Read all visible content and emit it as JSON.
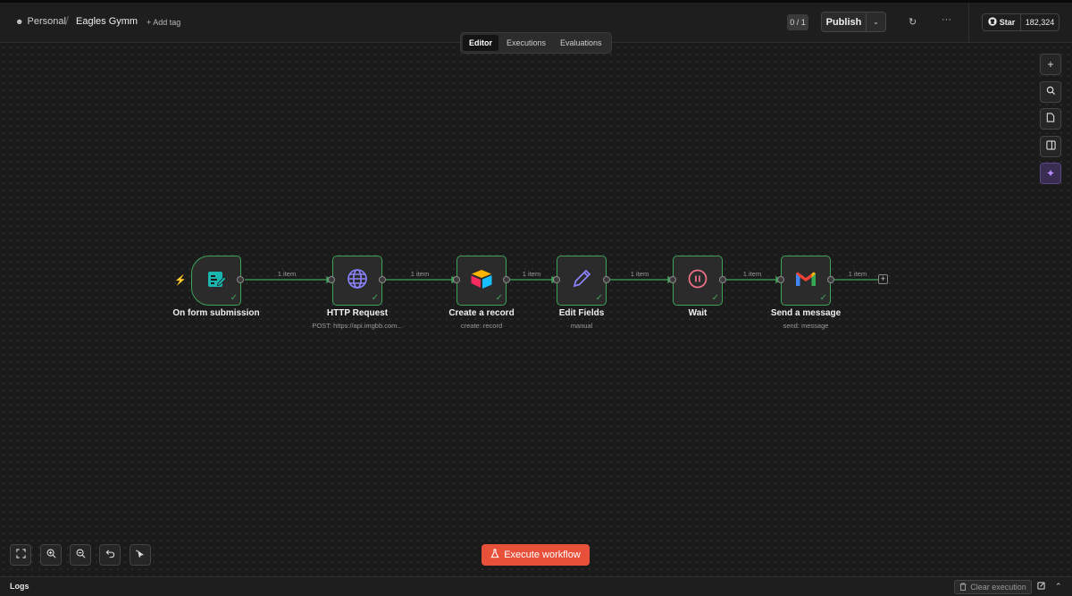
{
  "header": {
    "personal": "Personal",
    "separator": "/",
    "workflow_name": "Eagles Gymm",
    "add_tag": "+ Add tag",
    "counter": "0 / 1",
    "publish": "Publish",
    "more": "···",
    "github_star": "Star",
    "github_count": "182,324"
  },
  "tabs": [
    {
      "label": "Editor",
      "active": true
    },
    {
      "label": "Executions",
      "active": false
    },
    {
      "label": "Evaluations",
      "active": false
    }
  ],
  "nodes": [
    {
      "label": "On form submission",
      "sub": "",
      "icon": "form-icon"
    },
    {
      "label": "HTTP Request",
      "sub": "POST: https://api.imgbb.com...",
      "icon": "globe-icon"
    },
    {
      "label": "Create a record",
      "sub": "create: record",
      "icon": "airtable-icon"
    },
    {
      "label": "Edit Fields",
      "sub": "manual",
      "icon": "pencil-icon"
    },
    {
      "label": "Wait",
      "sub": "",
      "icon": "pause-icon"
    },
    {
      "label": "Send a message",
      "sub": "send: message",
      "icon": "gmail-icon"
    }
  ],
  "connections": [
    "1 item",
    "1 item",
    "1 item",
    "1 item",
    "1 item",
    "1 item"
  ],
  "execute_label": "Execute workflow",
  "logs": {
    "title": "Logs",
    "clear": "Clear execution"
  },
  "colors": {
    "accent": "#e8503a",
    "success": "#3fa35a",
    "ai": "#b68cff"
  }
}
